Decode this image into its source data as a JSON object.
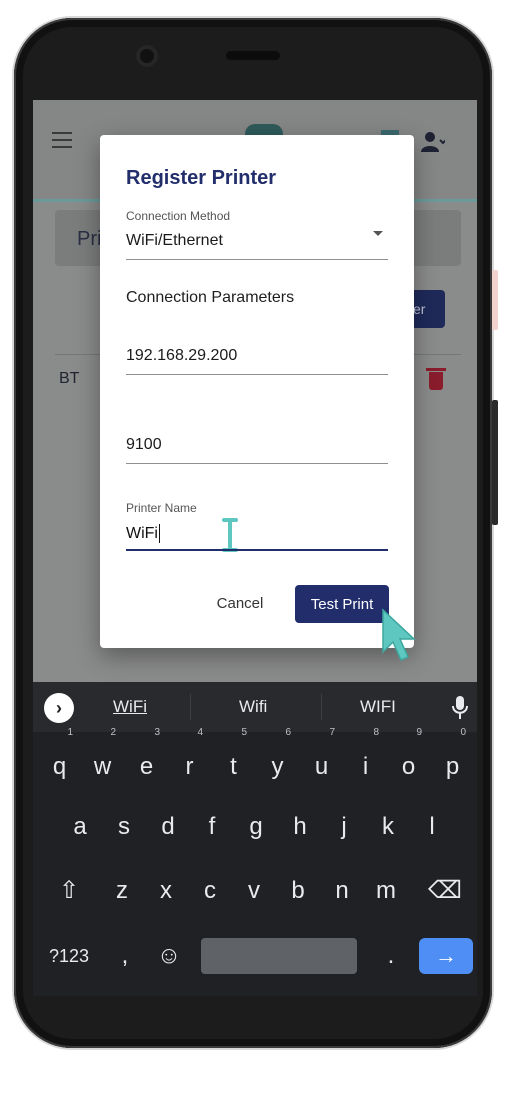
{
  "app": {
    "page_tab_label": "Pri",
    "background_button_label": "er",
    "list_item_label": "BT"
  },
  "dialog": {
    "title": "Register Printer",
    "connection_method": {
      "caption": "Connection Method",
      "value": "WiFi/Ethernet"
    },
    "section_label": "Connection Parameters",
    "ip_address": "192.168.29.200",
    "port": "9100",
    "printer_name": {
      "caption": "Printer Name",
      "value": "WiFi"
    },
    "cancel_label": "Cancel",
    "test_print_label": "Test Print"
  },
  "keyboard": {
    "suggestions": [
      "WiFi",
      "Wifi",
      "WIFI"
    ],
    "row1": [
      {
        "key": "q",
        "hint": "1"
      },
      {
        "key": "w",
        "hint": "2"
      },
      {
        "key": "e",
        "hint": "3"
      },
      {
        "key": "r",
        "hint": "4"
      },
      {
        "key": "t",
        "hint": "5"
      },
      {
        "key": "y",
        "hint": "6"
      },
      {
        "key": "u",
        "hint": "7"
      },
      {
        "key": "i",
        "hint": "8"
      },
      {
        "key": "o",
        "hint": "9"
      },
      {
        "key": "p",
        "hint": "0"
      }
    ],
    "row2": [
      "a",
      "s",
      "d",
      "f",
      "g",
      "h",
      "j",
      "k",
      "l"
    ],
    "row3": [
      "z",
      "x",
      "c",
      "v",
      "b",
      "n",
      "m"
    ],
    "symbols_label": "?123",
    "comma": ",",
    "period": ".",
    "emoji_glyph": "☺",
    "shift_glyph": "⇧",
    "backspace_glyph": "⌫",
    "enter_glyph": "→",
    "suggest_arrow_glyph": "›"
  },
  "colors": {
    "dialog_accent": "#222e6b",
    "enter_key": "#4e8ef5",
    "delete_icon": "#8a1c2c",
    "pointer": "#5ec7c0"
  }
}
